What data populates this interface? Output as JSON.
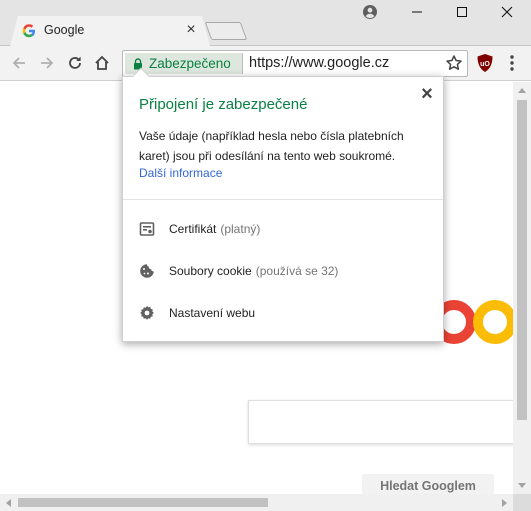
{
  "tab": {
    "title": "Google",
    "close": "×"
  },
  "toolbar": {
    "secure_label": "Zabezpečeno",
    "url": "https://www.google.cz"
  },
  "popup": {
    "title": "Připojení je zabezpečené",
    "close": "×",
    "description": "Vaše údaje (například hesla nebo čísla platebních karet) jsou při odesílání na tento web soukromé.",
    "more_info": "Další informace",
    "rows": [
      {
        "label": "Certifikát",
        "sub": "(platný)",
        "icon": "certificate-icon"
      },
      {
        "label": "Soubory cookie",
        "sub": "(používá se 32)",
        "icon": "cookie-icon"
      },
      {
        "label": "Nastavení webu",
        "sub": "",
        "icon": "gear-icon"
      }
    ]
  },
  "page": {
    "search_button": "Hledat Googlem"
  },
  "colors": {
    "secure_green": "#0b8043",
    "link_blue": "#3367d6",
    "google_blue": "#4285f4",
    "google_red": "#ea4335",
    "google_yellow": "#fbbc05"
  }
}
